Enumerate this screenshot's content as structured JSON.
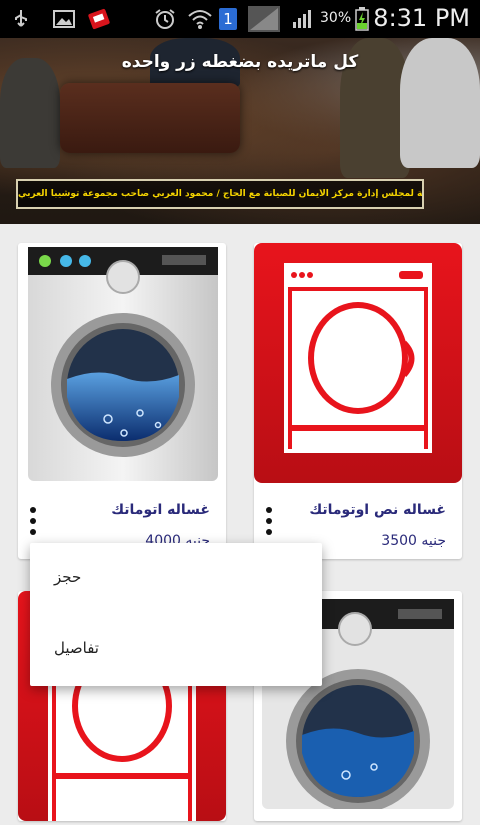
{
  "status_bar": {
    "time": "8:31 PM",
    "battery": "30%",
    "sim_badge": "1",
    "icons": [
      "usb-icon",
      "image-icon",
      "app-icon",
      "alarm-icon",
      "wifi-icon",
      "sim-icon",
      "signal-icon",
      "battery-icon"
    ]
  },
  "banner": {
    "title": "كل ماتريده بضغطه زر واحده",
    "caption": "صورة تذكارية لمجلس إدارة مركز الايمان للصيانة مع الحاج / محمود العربي صاحب مجموعة توشيبا العربي"
  },
  "products": [
    {
      "name": "غساله نص اوتوماتك",
      "price": "3500 جنيه",
      "image": "red-washer"
    },
    {
      "name": "غساله اتوماتك",
      "price": "4000 جنيه",
      "image": "front-load-washer"
    },
    {
      "name": "",
      "price": "",
      "image": "front-load-washer"
    },
    {
      "name": "",
      "price": "",
      "image": "red-washer"
    }
  ],
  "menu": {
    "items": [
      "حجز",
      "تفاصيل"
    ]
  },
  "colors": {
    "accent_red": "#d8141c",
    "text_blue": "#2a2a7a",
    "caption_yellow": "#f5d400"
  }
}
